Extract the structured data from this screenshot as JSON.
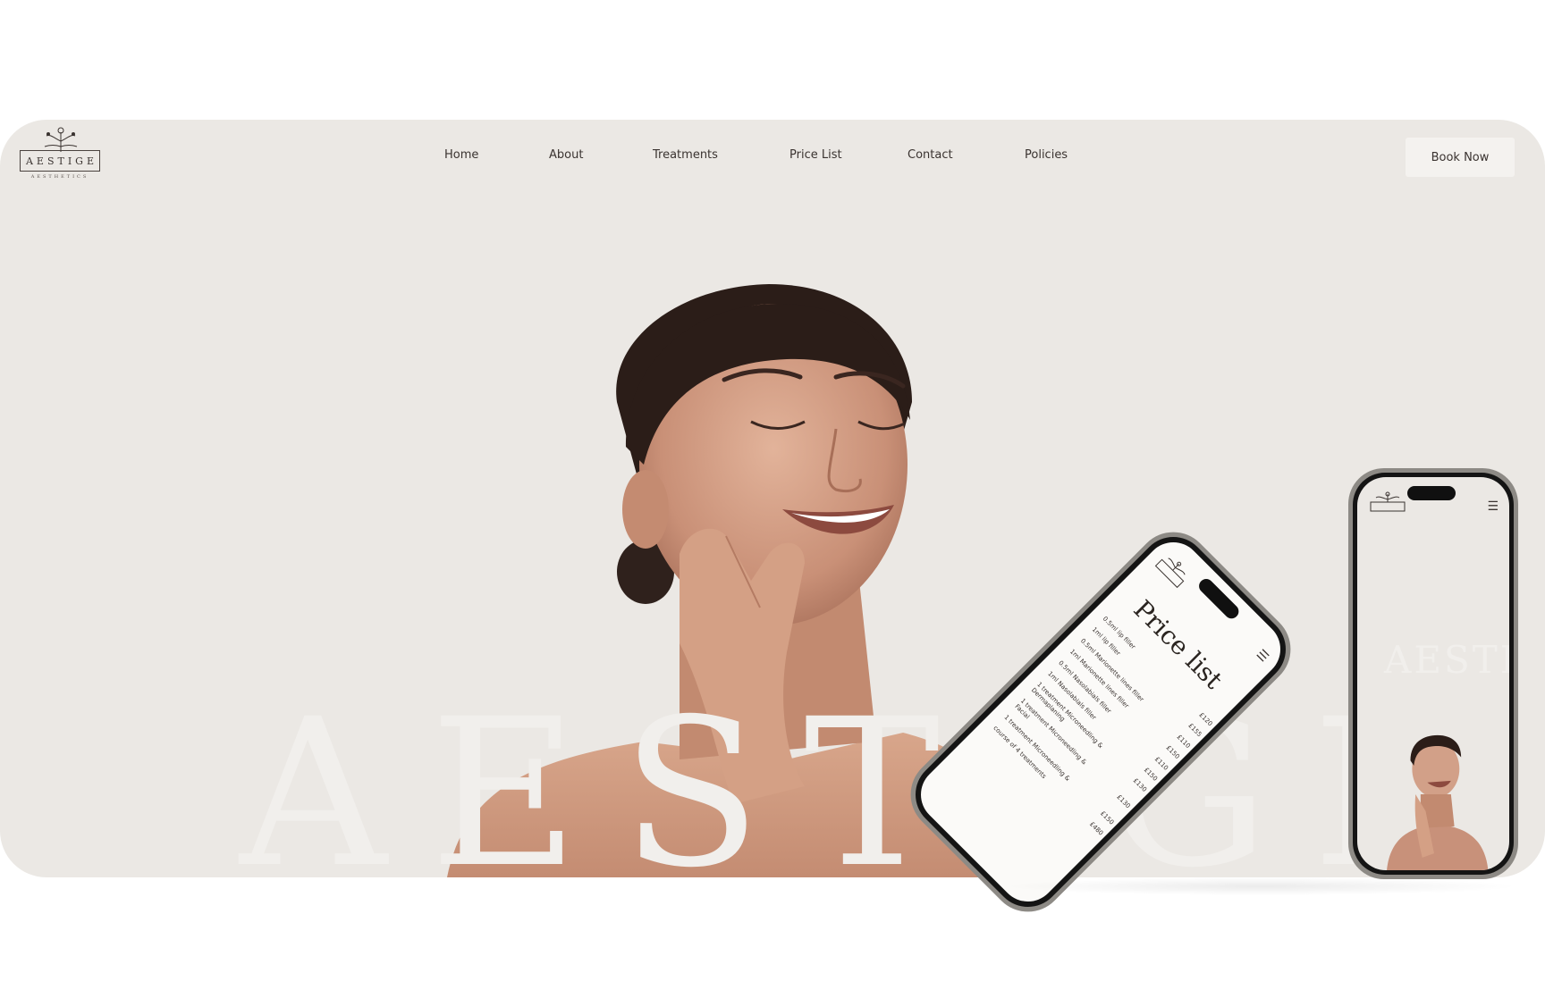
{
  "brand": {
    "name": "AESTIGE",
    "tagline": "AESTHETICS"
  },
  "nav": {
    "items": [
      {
        "label": "Home"
      },
      {
        "label": "About"
      },
      {
        "label": "Treatments"
      },
      {
        "label": "Price List"
      },
      {
        "label": "Contact"
      },
      {
        "label": "Policies"
      }
    ],
    "cta_label": "Book Now"
  },
  "hero": {
    "watermark": "AESTIGE",
    "image": "smiling-woman-portrait"
  },
  "mobile_price_list": {
    "title": "Price list",
    "menu_icon": "hamburger-icon",
    "rows": [
      {
        "name": "0.5ml lip filler",
        "price": "£120"
      },
      {
        "name": "1ml lip filler",
        "price": "£155"
      },
      {
        "name": "0.5ml Marionette lines filler",
        "price": "£110"
      },
      {
        "name": "1ml Marionette lines filler",
        "price": "£150"
      },
      {
        "name": "0.5ml Nasolabials filler",
        "price": "£110"
      },
      {
        "name": "1ml Nasolabials filler",
        "price": "£150"
      },
      {
        "name": "1 treatment Microneedling & Dermaplaning",
        "price": "£130"
      },
      {
        "name": "1 treatment Microneedling & Facial",
        "price": "£130"
      },
      {
        "name": "1 treatment Microneedling &",
        "price": "£150"
      },
      {
        "name": "course of 4 treatments",
        "price": "£480"
      }
    ]
  },
  "mobile_home": {
    "brand": "AESTIGE",
    "menu_icon": "hamburger-icon",
    "watermark": "AESTIGE"
  },
  "colors": {
    "hero_bg": "#ebe8e4",
    "text": "#3a3330",
    "button_bg": "#f4f2ef"
  }
}
